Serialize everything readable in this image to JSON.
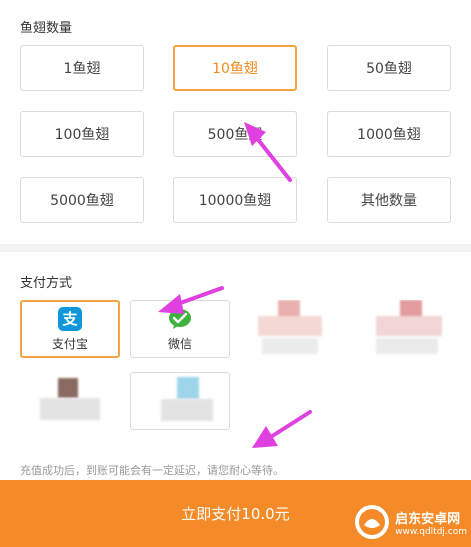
{
  "amount_section": {
    "title": "鱼翅数量",
    "options": [
      "1鱼翅",
      "10鱼翅",
      "50鱼翅",
      "100鱼翅",
      "500鱼翅",
      "1000鱼翅",
      "5000鱼翅",
      "10000鱼翅",
      "其他数量"
    ],
    "selected_index": 1
  },
  "payment_section": {
    "title": "支付方式",
    "methods": [
      {
        "label": "支付宝",
        "icon": "alipay-icon"
      },
      {
        "label": "微信",
        "icon": "wechat-icon"
      }
    ]
  },
  "notice": "充值成功后，到账可能会有一定延迟，请您耐心等待。",
  "pay_button": "立即支付10.0元",
  "watermark": {
    "name": "启东安卓网",
    "url": "www.qdltdj.com"
  },
  "colors": {
    "accent": "#f48b28",
    "selected_border": "#f5a340",
    "alipay": "#1296db",
    "wechat": "#3fb33e",
    "arrow": "#e040e0"
  }
}
